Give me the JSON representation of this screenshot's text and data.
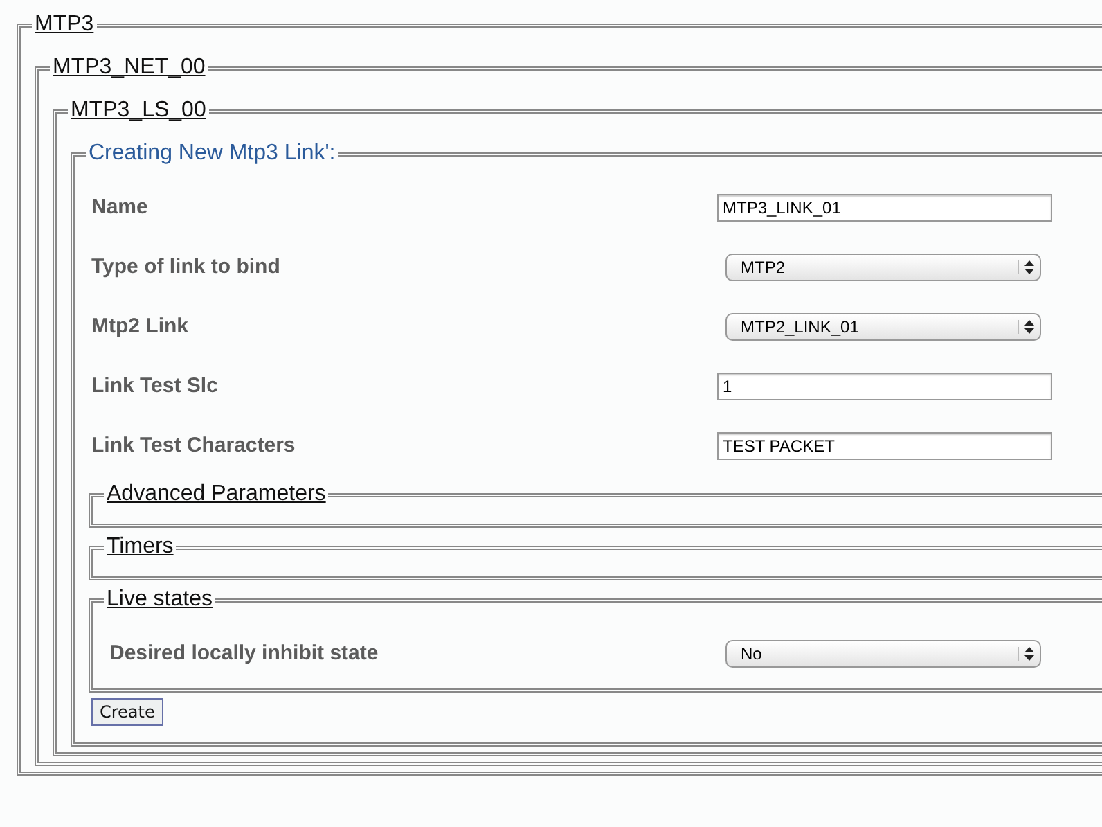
{
  "sections": [
    {
      "legend": "MTP3",
      "kind": "section",
      "items": [
        {
          "kind": "section",
          "legend": "MTP3_NET_00",
          "items": [
            {
              "kind": "section",
              "legend": "MTP3_LS_00",
              "items": [
                {
                  "kind": "form",
                  "legend": "Creating New Mtp3 Link':",
                  "items": [
                    {
                      "kind": "text",
                      "label": "Name",
                      "value": "MTP3_LINK_01"
                    },
                    {
                      "kind": "select",
                      "label": "Type of link to bind",
                      "value": "MTP2"
                    },
                    {
                      "kind": "select",
                      "label": "Mtp2 Link",
                      "value": "MTP2_LINK_01"
                    },
                    {
                      "kind": "text",
                      "label": "Link Test Slc",
                      "value": "1"
                    },
                    {
                      "kind": "text",
                      "label": "Link Test Characters",
                      "value": "TEST PACKET"
                    },
                    {
                      "kind": "section",
                      "legend": "Advanced Parameters"
                    },
                    {
                      "kind": "section",
                      "legend": "Timers"
                    },
                    {
                      "kind": "section",
                      "legend": "Live states",
                      "items": [
                        {
                          "kind": "select",
                          "label": "Desired locally inhibit state",
                          "value": "No"
                        }
                      ]
                    },
                    {
                      "kind": "button",
                      "label": "Create"
                    }
                  ]
                }
              ]
            }
          ]
        }
      ]
    }
  ]
}
